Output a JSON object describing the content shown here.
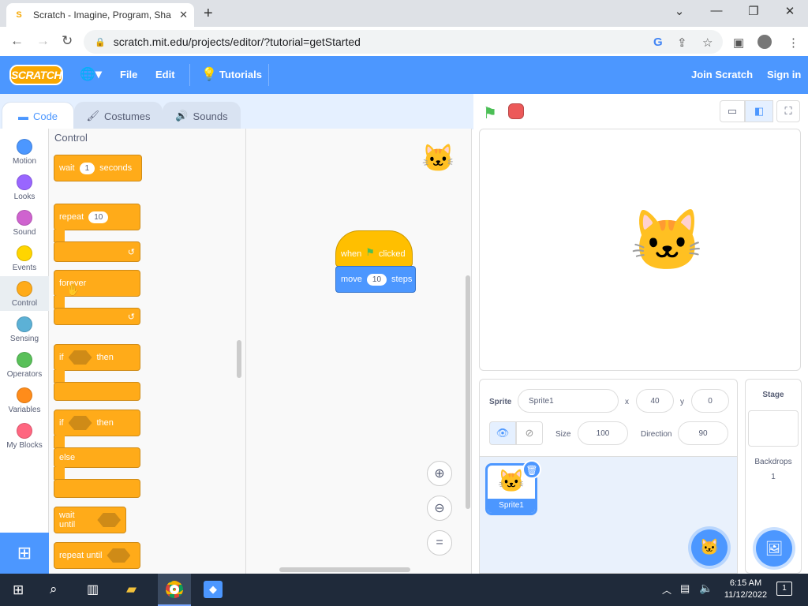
{
  "browser": {
    "tab_title": "Scratch - Imagine, Program, Sha",
    "url": "scratch.mit.edu/projects/editor/?tutorial=getStarted"
  },
  "menubar": {
    "logo": "SCRATCH",
    "file": "File",
    "edit": "Edit",
    "tutorials": "Tutorials",
    "join": "Join Scratch",
    "signin": "Sign in"
  },
  "tabs": {
    "code": "Code",
    "costumes": "Costumes",
    "sounds": "Sounds"
  },
  "categories": [
    {
      "label": "Motion",
      "color": "#4c97ff"
    },
    {
      "label": "Looks",
      "color": "#9966ff"
    },
    {
      "label": "Sound",
      "color": "#cf63cf"
    },
    {
      "label": "Events",
      "color": "#ffd500"
    },
    {
      "label": "Control",
      "color": "#ffab19"
    },
    {
      "label": "Sensing",
      "color": "#5cb1d6"
    },
    {
      "label": "Operators",
      "color": "#59c059"
    },
    {
      "label": "Variables",
      "color": "#ff8c1a"
    },
    {
      "label": "My Blocks",
      "color": "#ff6680"
    }
  ],
  "palette": {
    "heading": "Control",
    "wait": {
      "pre": "wait",
      "val": "1",
      "post": "seconds"
    },
    "repeat": {
      "pre": "repeat",
      "val": "10"
    },
    "forever": "forever",
    "if_then": {
      "pre": "if",
      "post": "then"
    },
    "if_else": {
      "pre": "if",
      "post": "then",
      "else": "else"
    },
    "wait_until": "wait until",
    "repeat_until": "repeat until"
  },
  "script": {
    "hat": {
      "pre": "when",
      "post": "clicked"
    },
    "move": {
      "pre": "move",
      "val": "10",
      "post": "steps"
    }
  },
  "sprite_info": {
    "sprite_label": "Sprite",
    "sprite_name": "Sprite1",
    "x_label": "x",
    "x": "40",
    "y_label": "y",
    "y": "0",
    "size_label": "Size",
    "size": "100",
    "direction_label": "Direction",
    "direction": "90"
  },
  "sprite_list": {
    "thumb_label": "Sprite1"
  },
  "stage_panel": {
    "title": "Stage",
    "backdrops_label": "Backdrops",
    "backdrops_count": "1"
  },
  "taskbar": {
    "time": "6:15 AM",
    "date": "11/12/2022",
    "notif_count": "1"
  }
}
